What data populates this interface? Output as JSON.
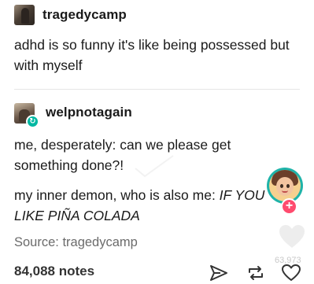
{
  "posts": [
    {
      "username": "tragedycamp",
      "avatar_icon": "user-avatar-icon",
      "text": "adhd is so funny it's like being possessed but with myself"
    },
    {
      "username": "welpnotagain",
      "avatar_icon": "user-avatar-icon",
      "badge_icon": "reblog-badge-icon",
      "text_lines": [
        "me, desperately: can we please get something done?!"
      ],
      "reply_prefix": "my inner demon, who is also me: ",
      "reply_italic": "IF YOU LIKE PIÑA COLADA"
    }
  ],
  "source": "Source: tragedycamp",
  "notes": "84,088 notes",
  "like_count": "63,973",
  "plus_badge": "+",
  "reblog_badge": "↻",
  "actions": {
    "share_icon": "share-icon",
    "reblog_icon": "reblog-icon",
    "like_icon": "heart-icon"
  },
  "colors": {
    "text": "#1a1a1a",
    "muted": "#6b6b6b",
    "reblog_green": "#00b8a2",
    "plus_pink": "#ff4b6e"
  }
}
